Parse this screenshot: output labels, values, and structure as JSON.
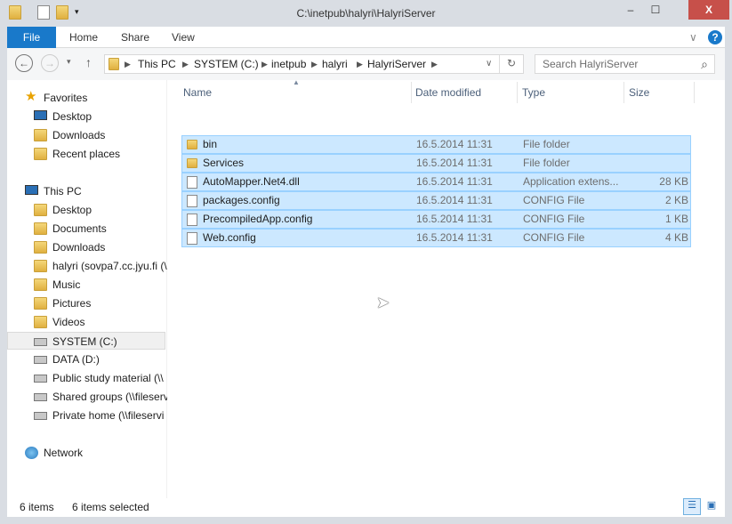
{
  "window": {
    "title": "C:\\inetpub\\halyri\\HalyriServer",
    "minimize": "–",
    "maximize": "☐",
    "close": "X"
  },
  "ribbon": {
    "tabs": [
      "File",
      "Home",
      "Share",
      "View"
    ],
    "expand": "∨",
    "help": "?"
  },
  "address": {
    "crumbs": [
      "This PC",
      "SYSTEM (C:)",
      "inetpub",
      "halyri",
      "HalyriServer"
    ],
    "search_placeholder": "Search HalyriServer",
    "back": "←",
    "forward": "→",
    "up": "↑",
    "recent": "▾",
    "refresh": "↻",
    "dropdown": "∨",
    "search_icon": "⌕"
  },
  "nav": {
    "favorites": {
      "label": "Favorites",
      "items": [
        "Desktop",
        "Downloads",
        "Recent places"
      ]
    },
    "thispc": {
      "label": "This PC",
      "items": [
        "Desktop",
        "Documents",
        "Downloads",
        "halyri (sovpa7.cc.jyu.fi (\\",
        "Music",
        "Pictures",
        "Videos",
        "SYSTEM (C:)",
        "DATA (D:)",
        "Public study material (\\\\",
        "Shared groups (\\\\fileserv",
        "Private home (\\\\fileservi"
      ]
    },
    "network": {
      "label": "Network"
    },
    "selected": "SYSTEM (C:)"
  },
  "columns": [
    "Name",
    "Date modified",
    "Type",
    "Size"
  ],
  "files": [
    {
      "name": "bin",
      "date": "16.5.2014 11:31",
      "type": "File folder",
      "size": "",
      "icon": "folder"
    },
    {
      "name": "Services",
      "date": "16.5.2014 11:31",
      "type": "File folder",
      "size": "",
      "icon": "folder"
    },
    {
      "name": "AutoMapper.Net4.dll",
      "date": "16.5.2014 11:31",
      "type": "Application extens...",
      "size": "28 KB",
      "icon": "dll"
    },
    {
      "name": "packages.config",
      "date": "16.5.2014 11:31",
      "type": "CONFIG File",
      "size": "2 KB",
      "icon": "file"
    },
    {
      "name": "PrecompiledApp.config",
      "date": "16.5.2014 11:31",
      "type": "CONFIG File",
      "size": "1 KB",
      "icon": "file"
    },
    {
      "name": "Web.config",
      "date": "16.5.2014 11:31",
      "type": "CONFIG File",
      "size": "4 KB",
      "icon": "file"
    }
  ],
  "status": {
    "items": "6 items",
    "selected": "6 items selected"
  },
  "colors": {
    "accent": "#1979ca",
    "selection": "#cce8ff",
    "close": "#c7504a"
  }
}
